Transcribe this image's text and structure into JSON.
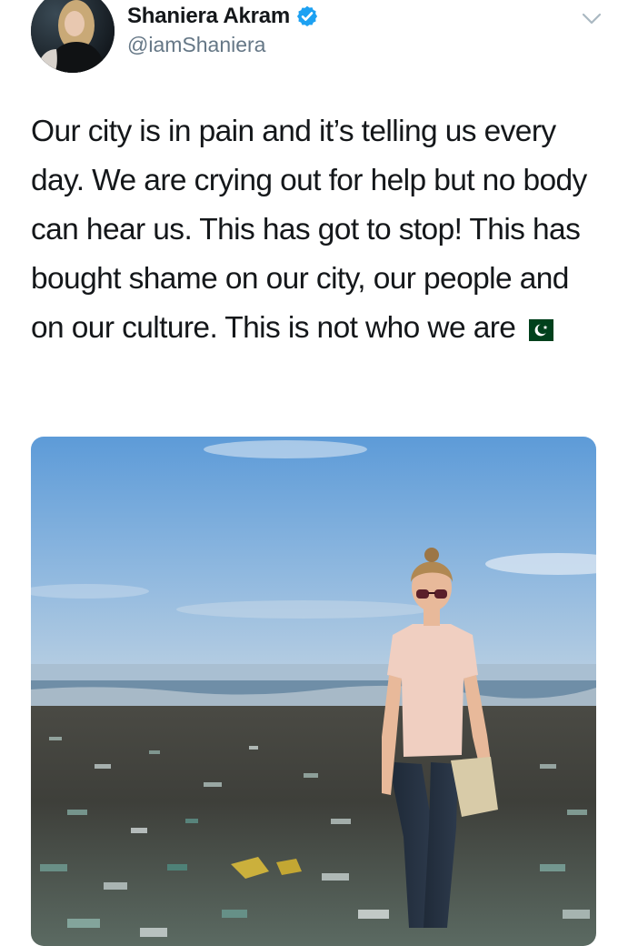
{
  "tweet": {
    "author": {
      "display_name": "Shaniera Akram",
      "handle": "@iamShaniera",
      "verified": true,
      "avatar_icon": "profile-photo"
    },
    "text": "Our city is in pain and it’s telling us every day. We are crying out for help but no body can hear us. This has got to stop! This has bought shame on our city, our people and on our culture. This is not who we are",
    "flag_icon": "pakistan-flag-icon",
    "menu_icon": "chevron-down-icon",
    "media": {
      "type": "photo",
      "icon": "photo-woman-on-littered-beach"
    }
  },
  "colors": {
    "verified_blue": "#1da1f2",
    "handle_gray": "#657786",
    "text_dark": "#14171a",
    "chevron_gray": "#aab8c2"
  }
}
